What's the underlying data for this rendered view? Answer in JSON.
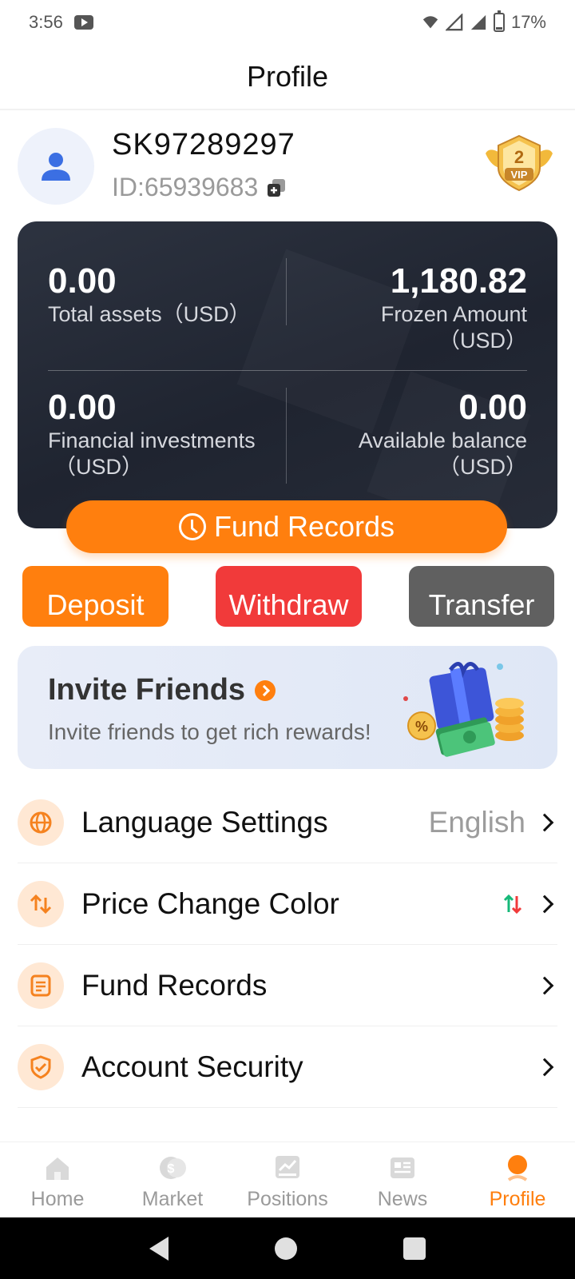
{
  "status_bar": {
    "time": "3:56",
    "battery": "17%"
  },
  "header": {
    "title": "Profile"
  },
  "profile": {
    "username": "SK97289297",
    "user_id": "ID:65939683",
    "vip_level": "2",
    "vip_text": "VIP"
  },
  "assets": {
    "total_assets_value": "0.00",
    "total_assets_label": "Total assets（USD）",
    "frozen_amount_value": "1,180.82",
    "frozen_amount_label_line1": "Frozen Amount",
    "frozen_amount_label_line2": "（USD）",
    "financial_value": "0.00",
    "financial_label_line1": "Financial investments",
    "financial_label_line2": "（USD）",
    "available_value": "0.00",
    "available_label_line1": "Available balance",
    "available_label_line2": "（USD）",
    "fund_records_label": "Fund Records"
  },
  "actions": {
    "deposit": "Deposit",
    "withdraw": "Withdraw",
    "transfer": "Transfer"
  },
  "invite": {
    "title": "Invite Friends",
    "subtitle": "Invite friends to get rich rewards!"
  },
  "menu": {
    "items": [
      {
        "label": "Language Settings",
        "value": "English",
        "icon": "globe-icon"
      },
      {
        "label": "Price Change Color",
        "value": "",
        "icon": "swap-arrows-icon"
      },
      {
        "label": "Fund Records",
        "value": "",
        "icon": "document-icon"
      },
      {
        "label": "Account Security",
        "value": "",
        "icon": "shield-check-icon"
      }
    ]
  },
  "tabs": [
    {
      "label": "Home",
      "icon": "home-icon",
      "active": false
    },
    {
      "label": "Market",
      "icon": "coin-icon",
      "active": false
    },
    {
      "label": "Positions",
      "icon": "chart-icon",
      "active": false
    },
    {
      "label": "News",
      "icon": "news-icon",
      "active": false
    },
    {
      "label": "Profile",
      "icon": "profile-icon",
      "active": true
    }
  ],
  "colors": {
    "accent": "#ff7f0e",
    "withdraw": "#f13a3a",
    "transfer": "#606060",
    "card_bg": "#23283a",
    "price_up": "#16b979",
    "price_down": "#f13a3a"
  }
}
